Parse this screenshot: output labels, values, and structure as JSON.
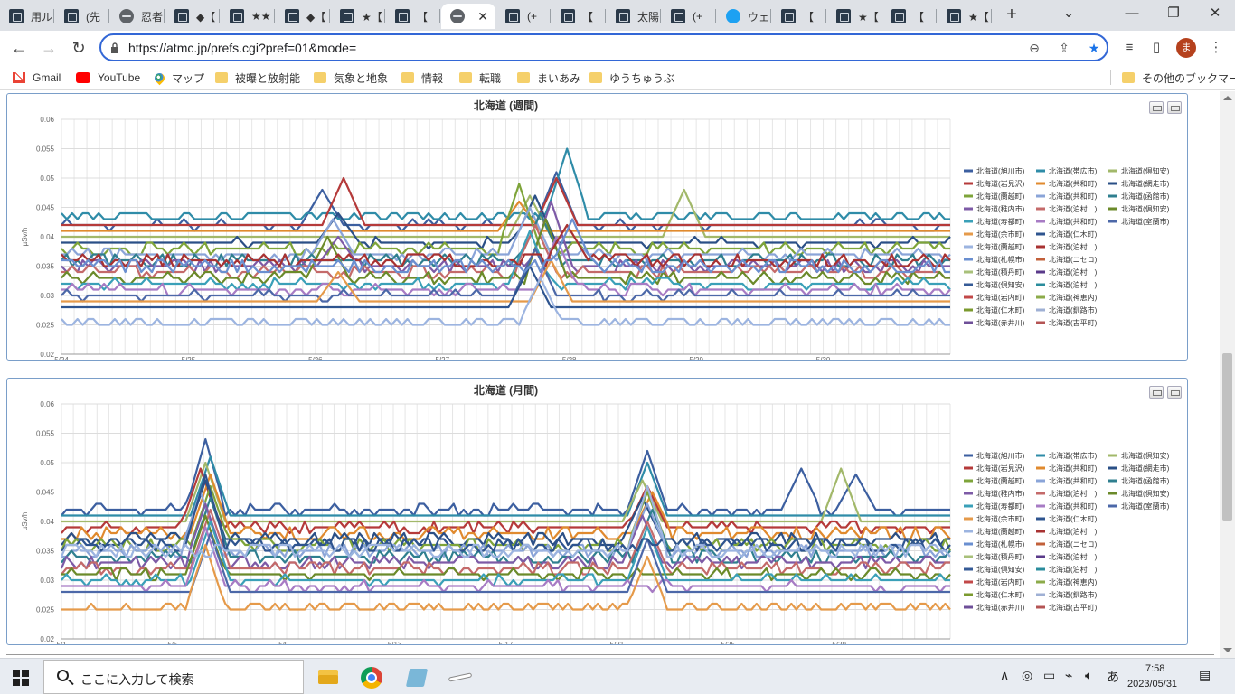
{
  "tabs": [
    {
      "title": "用ル",
      "icon": "site-icon"
    },
    {
      "title": "(先",
      "icon": "site-icon"
    },
    {
      "title": "忍者",
      "icon": "globe-icon"
    },
    {
      "title": "◆【",
      "icon": "site-icon"
    },
    {
      "title": "★★",
      "icon": "site-icon"
    },
    {
      "title": "◆【",
      "icon": "site-icon"
    },
    {
      "title": "★【",
      "icon": "site-icon"
    },
    {
      "title": "【",
      "icon": "site-icon"
    },
    {
      "title": "",
      "icon": "globe-icon",
      "active": true
    },
    {
      "title": "(+",
      "icon": "site-icon"
    },
    {
      "title": "【",
      "icon": "site-icon"
    },
    {
      "title": "太陽",
      "icon": "site-icon"
    },
    {
      "title": "(+",
      "icon": "site-icon"
    },
    {
      "title": "ウェ",
      "icon": "twitter-icon"
    },
    {
      "title": "【",
      "icon": "site-icon"
    },
    {
      "title": "★【",
      "icon": "site-icon"
    },
    {
      "title": "【",
      "icon": "site-icon"
    },
    {
      "title": "★【",
      "icon": "site-icon"
    }
  ],
  "toolbar": {
    "url": "https://atmc.jp/prefs.cgi?pref=01&mode=",
    "avatar_letter": "ま"
  },
  "bookmarks": [
    {
      "label": "Gmail",
      "icon": "gmail-icon"
    },
    {
      "label": "YouTube",
      "icon": "youtube-icon"
    },
    {
      "label": "マップ",
      "icon": "maps-icon"
    },
    {
      "label": "被曝と放射能",
      "icon": "folder-icon"
    },
    {
      "label": "気象と地象",
      "icon": "folder-icon"
    },
    {
      "label": "情報",
      "icon": "folder-icon"
    },
    {
      "label": "転職",
      "icon": "folder-icon"
    },
    {
      "label": "まいあみ",
      "icon": "folder-icon"
    },
    {
      "label": "ゆうちゅうぶ",
      "icon": "folder-icon"
    }
  ],
  "other_bookmarks": "その他のブックマーク",
  "legend_names": [
    "北海道(旭川市)",
    "北海道(帯広市)",
    "北海道(倶知安)",
    "北海道(岩見沢)",
    "北海道(共和町)",
    "北海道(網走市)",
    "北海道(蘭越町)",
    "北海道(共和町)",
    "北海道(函館市)",
    "北海道(稚内市)",
    "北海道(泊村　)",
    "北海道(倶知安)",
    "北海道(寿都町)",
    "北海道(共和町)",
    "北海道(室蘭市)",
    "北海道(余市町)",
    "北海道(仁木町)",
    "北海道(蘭越町)",
    "北海道(泊村　)",
    "北海道(札幌市)",
    "北海道(ニセコ)",
    "北海道(積丹町)",
    "北海道(泊村　)",
    "北海道(倶知安)",
    "北海道(泊村　)",
    "北海道(岩内町)",
    "北海道(神恵内)",
    "北海道(仁木町)",
    "北海道(釧路市)",
    "北海道(赤井川)",
    "北海道(古平町)"
  ],
  "legend_colors": [
    "#3c5fa0",
    "#2f8ca8",
    "#a2b86a",
    "#b53a3a",
    "#e08a2e",
    "#2a4f86",
    "#7ea43a",
    "#8aa4d8",
    "#2f7f8f",
    "#7d5aa6",
    "#c46a6a",
    "#6b8a2a",
    "#3aa0b8",
    "#a77bc4",
    "#4c68a8",
    "#e59a4a",
    "#2e548f",
    "#9cb4e0",
    "#a83232",
    "#6a8fd0",
    "#c2603a",
    "#a8c07a",
    "#5a3a8a",
    "#355a96",
    "#2a8c9c",
    "#c24848",
    "#8cab4a",
    "#7b9a2e",
    "#9fb0d4",
    "#6e4f98",
    "#b45454"
  ],
  "charts": [
    {
      "chart_data": {
        "type": "line",
        "title": "北海道 (週間)",
        "ylabel": "µSv/h",
        "ylim": [
          0.02,
          0.06
        ],
        "yticks": [
          "0.06",
          "0.055",
          "0.05",
          "0.045",
          "0.04",
          "0.035",
          "0.03",
          "0.025",
          "0.02"
        ],
        "xticks": [
          "5/24",
          "5/25",
          "5/26",
          "5/27",
          "5/28",
          "5/29",
          "5/30"
        ],
        "points_per_series": 168,
        "series": [
          {
            "base": 0.042,
            "noise": 0.0006,
            "spikes": [
              [
                49,
                0.048
              ],
              [
                93,
                0.051
              ]
            ]
          },
          {
            "base": 0.0435,
            "noise": 0.0004,
            "spikes": [
              [
                95,
                0.055
              ]
            ]
          },
          {
            "base": 0.04,
            "noise": 0.0003,
            "spikes": [
              [
                88,
                0.047
              ],
              [
                117,
                0.048
              ]
            ]
          },
          {
            "base": 0.042,
            "noise": 0.0003,
            "spikes": [
              [
                53,
                0.05
              ],
              [
                93,
                0.05
              ]
            ]
          },
          {
            "base": 0.041,
            "noise": 0.0003,
            "spikes": [
              [
                86,
                0.046
              ]
            ]
          },
          {
            "base": 0.039,
            "noise": 0.0006,
            "spikes": [
              [
                52,
                0.044
              ],
              [
                89,
                0.047
              ]
            ]
          },
          {
            "base": 0.038,
            "noise": 0.0008,
            "spikes": [
              [
                86,
                0.049
              ]
            ]
          },
          {
            "base": 0.037,
            "noise": 0.0007,
            "spikes": [
              [
                51,
                0.043
              ],
              [
                88,
                0.045
              ]
            ]
          },
          {
            "base": 0.036,
            "noise": 0.001,
            "spikes": [
              [
                90,
                0.044
              ]
            ]
          },
          {
            "base": 0.035,
            "noise": 0.0009,
            "spikes": [
              [
                52,
                0.04
              ],
              [
                92,
                0.046
              ]
            ]
          },
          {
            "base": 0.034,
            "noise": 0.0008,
            "spikes": [
              [
                89,
                0.042
              ]
            ]
          },
          {
            "base": 0.033,
            "noise": 0.0008,
            "spikes": [
              [
                50,
                0.04
              ],
              [
                91,
                0.043
              ]
            ]
          },
          {
            "base": 0.032,
            "noise": 0.0007,
            "spikes": [
              [
                88,
                0.041
              ]
            ]
          },
          {
            "base": 0.031,
            "noise": 0.0007,
            "spikes": [
              [
                93,
                0.04
              ]
            ]
          },
          {
            "base": 0.03,
            "noise": 0.0006,
            "spikes": [
              [
                89,
                0.038
              ]
            ]
          },
          {
            "base": 0.029,
            "noise": 0.0005,
            "spikes": [
              [
                52,
                0.034
              ],
              [
                92,
                0.036
              ]
            ]
          },
          {
            "base": 0.028,
            "noise": 0.0003,
            "spikes": [
              [
                88,
                0.035
              ]
            ]
          },
          {
            "base": 0.0255,
            "noise": 0.0004,
            "spikes": [
              [
                90,
                0.033
              ]
            ]
          },
          {
            "base": 0.036,
            "noise": 0.0012,
            "spikes": [
              [
                95,
                0.042
              ]
            ]
          },
          {
            "base": 0.035,
            "noise": 0.0012,
            "spikes": [
              [
                96,
                0.043
              ]
            ]
          }
        ]
      }
    },
    {
      "chart_data": {
        "type": "line",
        "title": "北海道 (月間)",
        "ylabel": "µSv/h",
        "ylim": [
          0.02,
          0.06
        ],
        "yticks": [
          "0.06",
          "0.055",
          "0.05",
          "0.045",
          "0.04",
          "0.035",
          "0.03",
          "0.025",
          "0.02"
        ],
        "xticks": [
          "5/1",
          "5/5",
          "5/9",
          "5/13",
          "5/17",
          "5/21",
          "5/25",
          "5/29"
        ],
        "points_per_series": 180,
        "series": [
          {
            "base": 0.042,
            "noise": 0.0008,
            "spikes": [
              [
                29,
                0.054
              ],
              [
                118,
                0.052
              ],
              [
                149,
                0.049
              ],
              [
                160,
                0.048
              ]
            ]
          },
          {
            "base": 0.041,
            "noise": 0.0005,
            "spikes": [
              [
                30,
                0.051
              ],
              [
                118,
                0.05
              ]
            ]
          },
          {
            "base": 0.04,
            "noise": 0.0005,
            "spikes": [
              [
                29,
                0.05
              ],
              [
                117,
                0.047
              ],
              [
                157,
                0.049
              ]
            ]
          },
          {
            "base": 0.039,
            "noise": 0.0008,
            "spikes": [
              [
                28,
                0.049
              ],
              [
                118,
                0.046
              ]
            ]
          },
          {
            "base": 0.038,
            "noise": 0.001,
            "spikes": [
              [
                30,
                0.048
              ],
              [
                119,
                0.045
              ]
            ]
          },
          {
            "base": 0.037,
            "noise": 0.0009,
            "spikes": [
              [
                29,
                0.047
              ],
              [
                117,
                0.044
              ]
            ]
          },
          {
            "base": 0.036,
            "noise": 0.0009,
            "spikes": [
              [
                30,
                0.046
              ],
              [
                118,
                0.045
              ]
            ]
          },
          {
            "base": 0.035,
            "noise": 0.001,
            "spikes": [
              [
                28,
                0.045
              ],
              [
                118,
                0.043
              ]
            ]
          },
          {
            "base": 0.034,
            "noise": 0.001,
            "spikes": [
              [
                30,
                0.044
              ],
              [
                119,
                0.042
              ]
            ]
          },
          {
            "base": 0.033,
            "noise": 0.0009,
            "spikes": [
              [
                29,
                0.043
              ],
              [
                117,
                0.041
              ]
            ]
          },
          {
            "base": 0.032,
            "noise": 0.0008,
            "spikes": [
              [
                30,
                0.042
              ],
              [
                118,
                0.04
              ]
            ]
          },
          {
            "base": 0.031,
            "noise": 0.0007,
            "spikes": [
              [
                29,
                0.041
              ]
            ]
          },
          {
            "base": 0.03,
            "noise": 0.0006,
            "spikes": [
              [
                30,
                0.04
              ],
              [
                118,
                0.039
              ]
            ]
          },
          {
            "base": 0.029,
            "noise": 0.0006,
            "spikes": [
              [
                29,
                0.039
              ]
            ]
          },
          {
            "base": 0.028,
            "noise": 0.0005,
            "spikes": [
              [
                30,
                0.038
              ],
              [
                118,
                0.037
              ]
            ]
          },
          {
            "base": 0.0255,
            "noise": 0.0003,
            "spikes": [
              [
                29,
                0.036
              ],
              [
                118,
                0.034
              ]
            ]
          },
          {
            "base": 0.036,
            "noise": 0.0013,
            "spikes": [
              [
                29,
                0.048
              ]
            ]
          },
          {
            "base": 0.035,
            "noise": 0.0013,
            "spikes": [
              [
                118,
                0.046
              ]
            ]
          }
        ]
      }
    }
  ],
  "taskbar": {
    "search_placeholder": "ここに入力して検索",
    "ime": "あ",
    "time": "7:58",
    "date": "2023/05/31"
  }
}
